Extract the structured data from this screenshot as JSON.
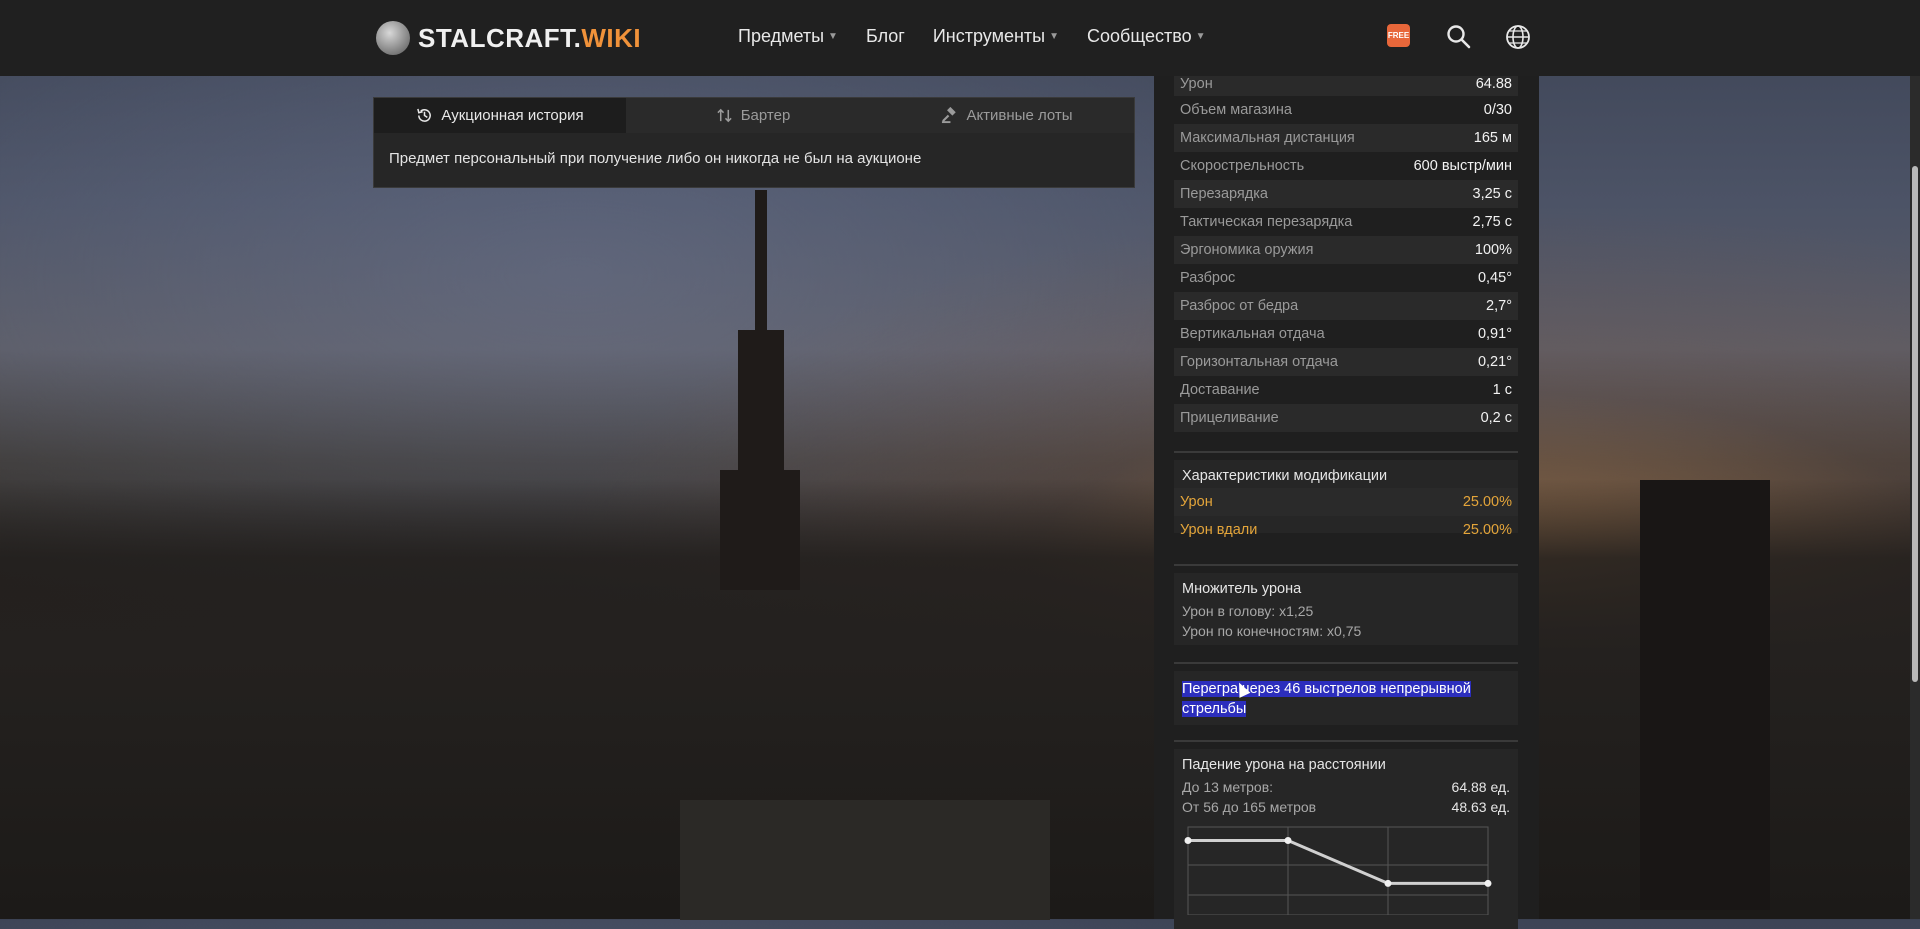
{
  "header": {
    "logo_main": "STALCRAFT.",
    "logo_wiki": "WIKI",
    "nav": [
      {
        "label": "Предметы",
        "caret": true
      },
      {
        "label": "Блог",
        "caret": false
      },
      {
        "label": "Инструменты",
        "caret": true
      },
      {
        "label": "Сообщество",
        "caret": true
      }
    ],
    "free_badge": "FREE",
    "icons": [
      "free-icon",
      "search-icon",
      "globe-icon"
    ]
  },
  "auction": {
    "tabs": [
      "Аукционная история",
      "Бартер",
      "Активные лоты"
    ],
    "active_tab": 0,
    "message": "Предмет персональный при получение либо он никогда не был на аукционе"
  },
  "stats": [
    {
      "key": "Урон",
      "value": "64.88"
    },
    {
      "key": "Объем магазина",
      "value": "0/30"
    },
    {
      "key": "Максимальная дистанция",
      "value": "165 м"
    },
    {
      "key": "Скорострельность",
      "value": "600 выстр/мин"
    },
    {
      "key": "Перезарядка",
      "value": "3,25 с"
    },
    {
      "key": "Тактическая перезарядка",
      "value": "2,75 с"
    },
    {
      "key": "Эргономика оружия",
      "value": "100%"
    },
    {
      "key": "Разброс",
      "value": "0,45°"
    },
    {
      "key": "Разброс от бедра",
      "value": "2,7°"
    },
    {
      "key": "Вертикальная отдача",
      "value": "0,91°"
    },
    {
      "key": "Горизонтальная отдача",
      "value": "0,21°"
    },
    {
      "key": "Доставание",
      "value": "1 с"
    },
    {
      "key": "Прицеливание",
      "value": "0,2 с"
    }
  ],
  "modifications": {
    "title": "Характеристики модификации",
    "rows": [
      {
        "key": "Урон",
        "value": "25.00%"
      },
      {
        "key": "Урон вдали",
        "value": "25.00%"
      }
    ],
    "accent": "#e4a53a"
  },
  "multiplier": {
    "title": "Множитель урона",
    "lines": [
      "Урон в голову: x1,25",
      "Урон по конечностям: x0,75"
    ]
  },
  "overheat": {
    "text": "Перегрев через 46 выстрелов непрерывной стрельбы",
    "visible_text": "Перегрa через 46 выстрелов непрерывной стрельбы"
  },
  "falloff": {
    "title": "Падение урона на расстоянии",
    "rows": [
      {
        "key": "До 13 метров:",
        "value": "64.88 ед."
      },
      {
        "key": "От 56 до 165 метров",
        "value": "48.63 ед."
      }
    ],
    "chart_points": [
      64.88,
      64.88,
      48.63,
      48.63
    ]
  }
}
